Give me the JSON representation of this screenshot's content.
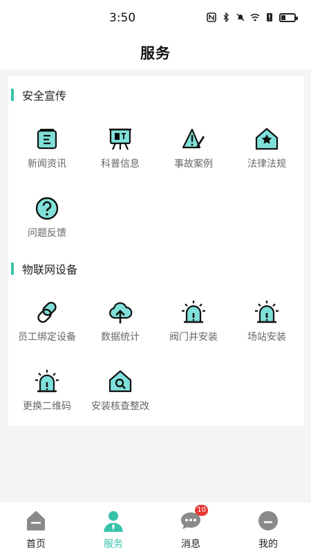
{
  "status_bar": {
    "time": "3:50",
    "icons": [
      "nfc-icon",
      "bluetooth-icon",
      "mute-icon",
      "wifi-icon",
      "alert-icon",
      "battery-icon"
    ]
  },
  "header": {
    "title": "服务"
  },
  "sections": [
    {
      "title": "安全宣传",
      "items": [
        {
          "label": "新闻资讯",
          "icon": "newspaper-icon"
        },
        {
          "label": "科普信息",
          "icon": "easel-icon"
        },
        {
          "label": "事故案例",
          "icon": "warning-pen-icon"
        },
        {
          "label": "法律法规",
          "icon": "law-house-icon"
        },
        {
          "label": "问题反馈",
          "icon": "question-icon"
        }
      ]
    },
    {
      "title": "物联网设备",
      "items": [
        {
          "label": "员工绑定设备",
          "icon": "link-icon"
        },
        {
          "label": "数据统计",
          "icon": "cloud-upload-icon"
        },
        {
          "label": "阀门井安装",
          "icon": "alarm-light-icon"
        },
        {
          "label": "场站安装",
          "icon": "alarm-light-icon"
        },
        {
          "label": "更换二维码",
          "icon": "alarm-light-icon"
        },
        {
          "label": "安装核查整改",
          "icon": "search-house-icon"
        }
      ]
    }
  ],
  "tabbar": {
    "tabs": [
      {
        "label": "首页",
        "icon": "home-icon"
      },
      {
        "label": "服务",
        "icon": "user-icon"
      },
      {
        "label": "消息",
        "icon": "chat-icon",
        "badge": "10"
      },
      {
        "label": "我的",
        "icon": "profile-icon"
      }
    ],
    "active": "服务"
  },
  "colors": {
    "accent": "#37c2a8",
    "icon_fill": "#7fe0d9",
    "badge": "#e53935"
  }
}
